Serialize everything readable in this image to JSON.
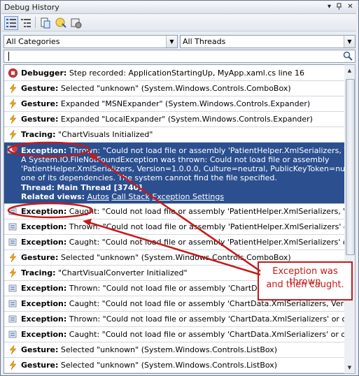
{
  "window": {
    "title": "Debug History"
  },
  "filters": {
    "category": "All Categories",
    "thread": "All Threads",
    "search_value": ""
  },
  "events": [
    {
      "icon": "stop-icon",
      "kind": "Debugger:",
      "text": "Step recorded: ApplicationStartingUp, MyApp.xaml.cs line 16"
    },
    {
      "icon": "lightning-icon",
      "kind": "Gesture:",
      "text": "Selected \"unknown\" (System.Windows.Controls.ComboBox)"
    },
    {
      "icon": "lightning-icon",
      "kind": "Gesture:",
      "text": "Expanded \"MSNExpander\" (System.Windows.Controls.Expander)"
    },
    {
      "icon": "lightning-icon",
      "kind": "Gesture:",
      "text": "Expanded \"LocalExpander\" (System.Windows.Controls.Expander)"
    },
    {
      "icon": "lightning-icon",
      "kind": "Tracing:",
      "text": "\"ChartVisuals Initialized\""
    }
  ],
  "selected": {
    "kind": "Exception:",
    "summary": "Thrown: \"Could not load file or assembly 'PatientHelper.XmlSerializers, Version=1.",
    "detail_lines": [
      "A System.IO.FileNotFoundException was thrown: Could not load file or assembly",
      "'PatientHelper.XmlSerializers, Version=1.0.0.0, Culture=neutral, PublicKeyToken=null' or",
      "one of its dependencies. The system cannot find the file specified."
    ],
    "thread_label": "Thread:",
    "thread_value": "Main Thread [3740]",
    "related_label": "Related views:",
    "related_links": [
      "Autos",
      "Call Stack",
      "Exception Settings"
    ]
  },
  "events_after": [
    {
      "icon": "exception-icon",
      "kind": "Exception:",
      "text": "Caught: \"Could not load file or assembly 'PatientHelper.XmlSerializers, Version=1."
    },
    {
      "icon": "exception-icon",
      "kind": "Exception:",
      "text": "Thrown: \"Could not load file or assembly 'PatientHelper.XmlSerializers' or one of it"
    },
    {
      "icon": "exception-icon",
      "kind": "Exception:",
      "text": "Caught: \"Could not load file or assembly 'PatientHelper.XmlSerializers' or one of it"
    },
    {
      "icon": "lightning-icon",
      "kind": "Gesture:",
      "text": "Selected \"unknown\" (System.Windows.Controls.ComboBox)"
    },
    {
      "icon": "lightning-icon",
      "kind": "Tracing:",
      "text": "\"ChartVisualConverter Initialized\""
    },
    {
      "icon": "exception-icon",
      "kind": "Exception:",
      "text": "Thrown: \"Could not load file or assembly 'ChartData.XmlSerializers, Version=1.0."
    },
    {
      "icon": "exception-icon",
      "kind": "Exception:",
      "text": "Caught: \"Could not load file or assembly 'ChartData.XmlSerializers, Version=1.0."
    },
    {
      "icon": "exception-icon",
      "kind": "Exception:",
      "text": "Thrown: \"Could not load file or assembly 'ChartData.XmlSerializers' or one of its c"
    },
    {
      "icon": "exception-icon",
      "kind": "Exception:",
      "text": "Caught: \"Could not load file or assembly 'ChartData.XmlSerializers' or one of its c"
    },
    {
      "icon": "lightning-icon",
      "kind": "Gesture:",
      "text": "Selected \"unknown\" (System.Windows.Controls.ListBox)"
    },
    {
      "icon": "lightning-icon",
      "kind": "Gesture:",
      "text": "Selected \"unknown\" (System.Windows.Controls.ListBox)"
    }
  ],
  "annotation": {
    "line1": "Exception was thrown",
    "line2": "and then caught."
  },
  "colors": {
    "selection": "#2b4f8f",
    "annotation": "#c41a1a",
    "lightning": "#f0a020",
    "stop": "#d83a3a"
  }
}
